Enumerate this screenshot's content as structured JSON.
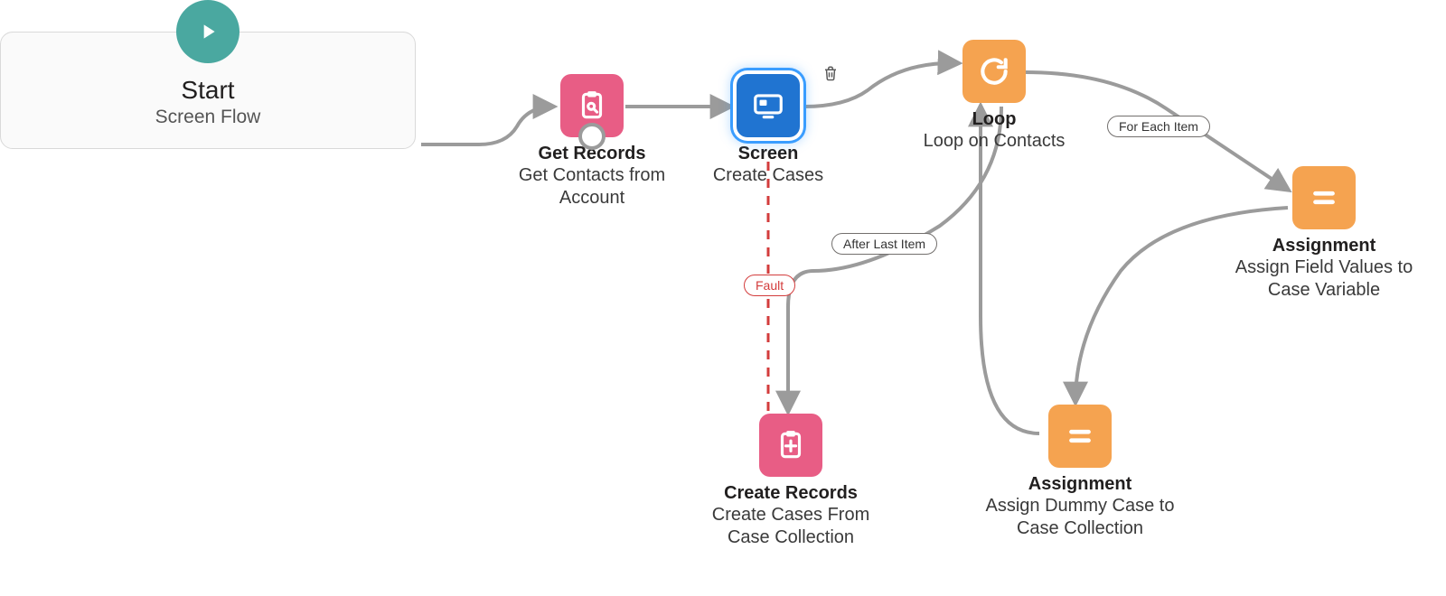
{
  "start": {
    "title": "Start",
    "subtitle": "Screen Flow",
    "icon": "play-icon"
  },
  "nodes": {
    "get_records": {
      "type": "Get Records",
      "label": "Get Contacts from Account",
      "icon": "clipboard-search-icon",
      "color": "#e85d85"
    },
    "screen": {
      "type": "Screen",
      "label": "Create Cases",
      "icon": "screen-icon",
      "color": "#2074d1",
      "selected": true
    },
    "loop": {
      "type": "Loop",
      "label": "Loop on Contacts",
      "icon": "loop-icon",
      "color": "#f5a350"
    },
    "assignment_field_values": {
      "type": "Assignment",
      "label": "Assign Field Values to Case Variable",
      "icon": "equals-icon",
      "color": "#f5a350"
    },
    "assignment_dummy": {
      "type": "Assignment",
      "label": "Assign Dummy Case to Case Collection",
      "icon": "equals-icon",
      "color": "#f5a350"
    },
    "create_records": {
      "type": "Create Records",
      "label": "Create Cases From Case Collection",
      "icon": "clipboard-plus-icon",
      "color": "#e85d85"
    }
  },
  "connectors": {
    "for_each": "For Each Item",
    "after_last": "After Last Item",
    "fault": "Fault"
  },
  "toolbar": {
    "delete": "delete-icon"
  }
}
